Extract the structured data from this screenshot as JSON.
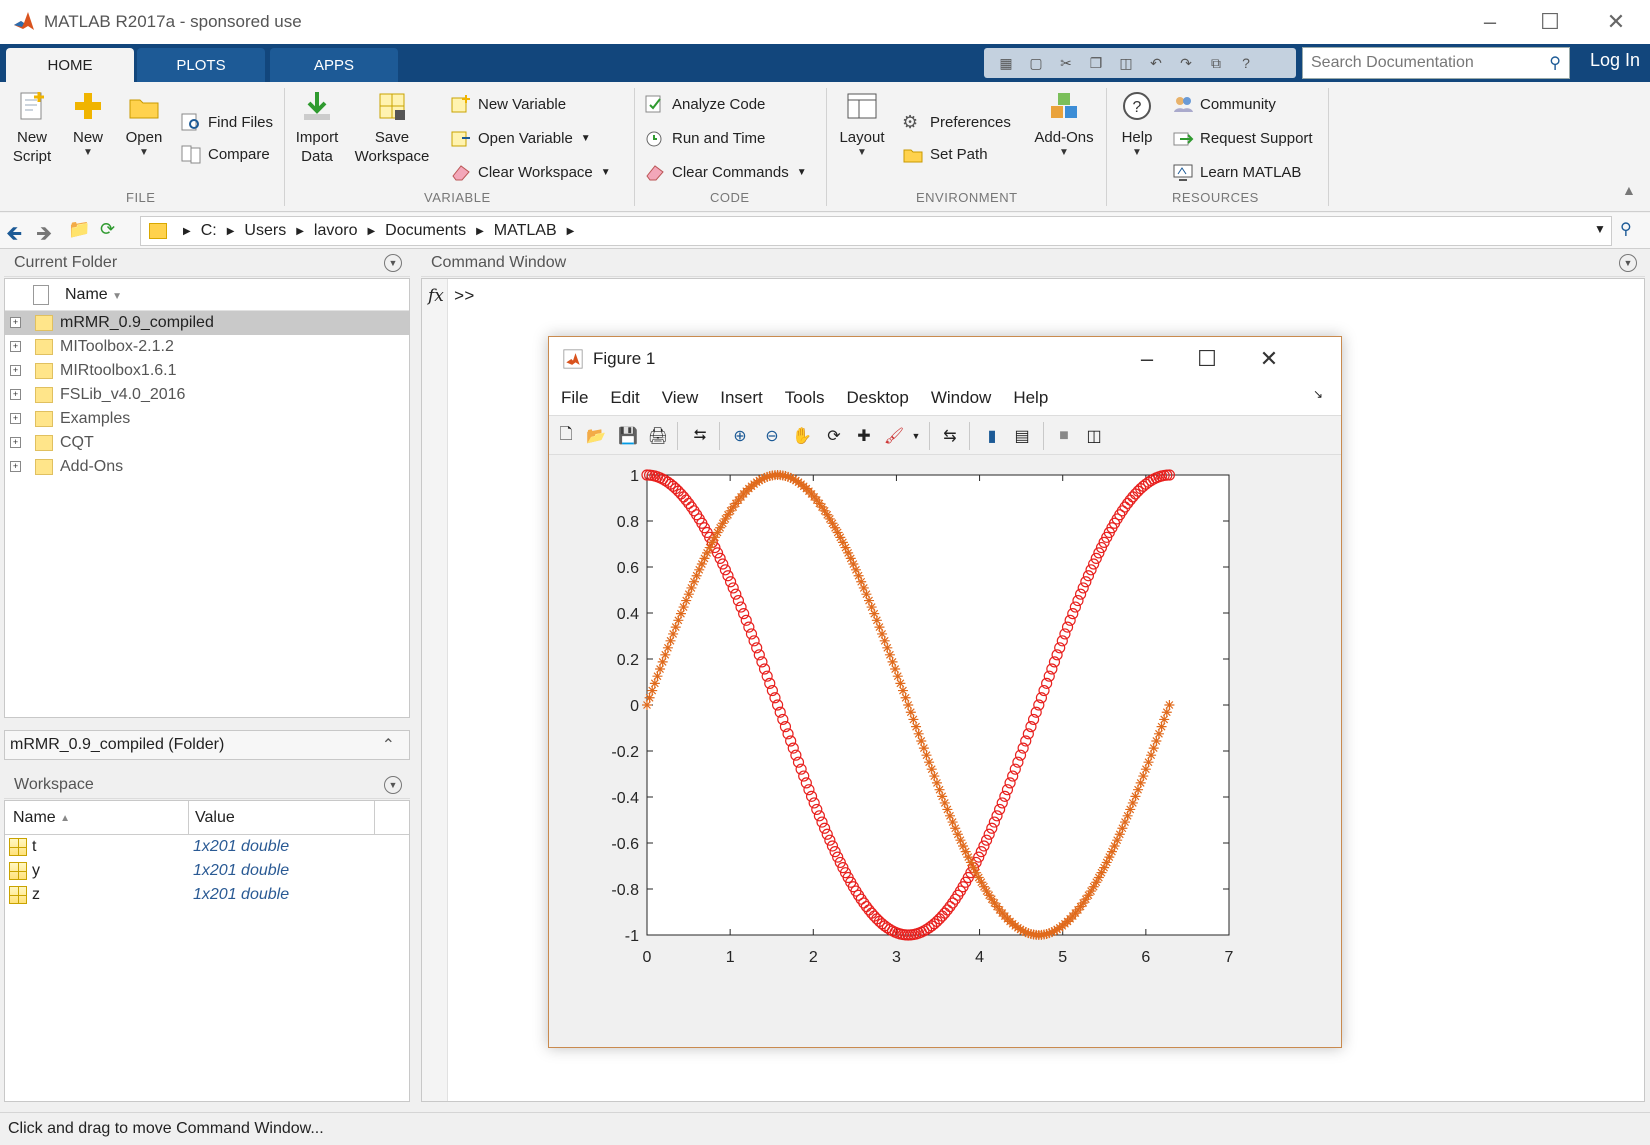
{
  "window": {
    "title": "MATLAB R2017a - sponsored use"
  },
  "tabs": [
    {
      "label": "HOME"
    },
    {
      "label": "PLOTS"
    },
    {
      "label": "APPS"
    }
  ],
  "search": {
    "placeholder": "Search Documentation"
  },
  "login": {
    "label": "Log In"
  },
  "ribbon": {
    "file": {
      "group": "FILE",
      "new_script": "New\nScript",
      "new": "New",
      "open": "Open",
      "find_files": "Find Files",
      "compare": "Compare"
    },
    "variable": {
      "group": "VARIABLE",
      "import_data": "Import\nData",
      "save_workspace": "Save\nWorkspace",
      "new_variable": "New Variable",
      "open_variable": "Open Variable",
      "clear_workspace": "Clear Workspace"
    },
    "code": {
      "group": "CODE",
      "analyze_code": "Analyze Code",
      "run_and_time": "Run and Time",
      "clear_commands": "Clear Commands"
    },
    "environment": {
      "group": "ENVIRONMENT",
      "layout": "Layout",
      "preferences": "Preferences",
      "set_path": "Set Path",
      "add_ons": "Add-Ons"
    },
    "resources": {
      "group": "RESOURCES",
      "help": "Help",
      "community": "Community",
      "request_support": "Request Support",
      "learn_matlab": "Learn MATLAB"
    }
  },
  "path": [
    "C:",
    "Users",
    "lavoro",
    "Documents",
    "MATLAB"
  ],
  "current_folder": {
    "title": "Current Folder",
    "column": "Name",
    "items": [
      {
        "label": "mRMR_0.9_compiled",
        "selected": true
      },
      {
        "label": "MIToolbox-2.1.2"
      },
      {
        "label": "MIRtoolbox1.6.1"
      },
      {
        "label": "FSLib_v4.0_2016"
      },
      {
        "label": "Examples"
      },
      {
        "label": "CQT"
      },
      {
        "label": "Add-Ons"
      }
    ],
    "details": "mRMR_0.9_compiled  (Folder)"
  },
  "workspace": {
    "title": "Workspace",
    "columns": {
      "name": "Name",
      "value": "Value"
    },
    "rows": [
      {
        "name": "t",
        "value": "1x201 double"
      },
      {
        "name": "y",
        "value": "1x201 double"
      },
      {
        "name": "z",
        "value": "1x201 double"
      }
    ]
  },
  "command_window": {
    "title": "Command Window",
    "fx": "fx",
    "prompt": ">>"
  },
  "status": "Click and drag to move Command Window...",
  "figure": {
    "title": "Figure 1",
    "menu": [
      "File",
      "Edit",
      "View",
      "Insert",
      "Tools",
      "Desktop",
      "Window",
      "Help"
    ]
  },
  "colors": {
    "accent": "#12467c",
    "series_cos": "#e8201e",
    "series_sin": "#e06a1c"
  },
  "chart_data": {
    "type": "scatter",
    "title": "",
    "xlabel": "",
    "ylabel": "",
    "xlim": [
      0,
      7
    ],
    "ylim": [
      -1,
      1
    ],
    "xticks": [
      0,
      1,
      2,
      3,
      4,
      5,
      6,
      7
    ],
    "yticks": [
      -1,
      -0.8,
      -0.6,
      -0.4,
      -0.2,
      0,
      0.2,
      0.4,
      0.6,
      0.8,
      1
    ],
    "grid": false,
    "n_points": 201,
    "x_range": [
      0,
      6.2832
    ],
    "series": [
      {
        "marker": "o",
        "color": "#e8201e",
        "function": "cos(t)"
      },
      {
        "marker": "*",
        "color": "#e06a1c",
        "function": "sin(t)"
      }
    ]
  }
}
